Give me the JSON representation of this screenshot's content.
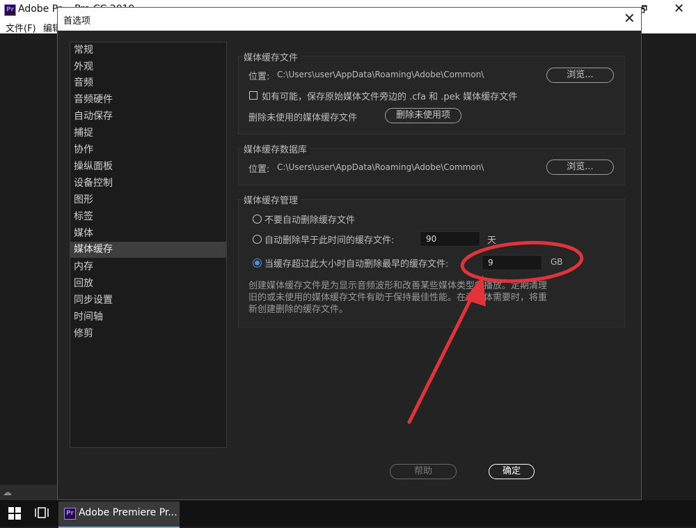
{
  "app": {
    "title": "Adobe Pr… Pro CC 2019",
    "menu": [
      "文件(F)",
      "编辑"
    ],
    "restore_glyph": "🗗",
    "close_glyph": "✕"
  },
  "taskbar": {
    "app_label": "Adobe Premiere Pr...",
    "app_logo": "Pr"
  },
  "dialog": {
    "title": "首选项",
    "close_glyph": "✕",
    "sidebar": [
      {
        "label": "常规"
      },
      {
        "label": "外观"
      },
      {
        "label": "音频"
      },
      {
        "label": "音频硬件"
      },
      {
        "label": "自动保存"
      },
      {
        "label": "捕捉"
      },
      {
        "label": "协作"
      },
      {
        "label": "操纵面板"
      },
      {
        "label": "设备控制"
      },
      {
        "label": "图形"
      },
      {
        "label": "标签"
      },
      {
        "label": "媒体"
      },
      {
        "label": "媒体缓存",
        "selected": true
      },
      {
        "label": "内存"
      },
      {
        "label": "回放"
      },
      {
        "label": "同步设置"
      },
      {
        "label": "时间轴"
      },
      {
        "label": "修剪"
      }
    ],
    "cache_files": {
      "title": "媒体缓存文件",
      "location_label": "位置:",
      "location_path": "C:\\Users\\user\\AppData\\Roaming\\Adobe\\Common\\",
      "browse_label": "浏览...",
      "save_next_label": "如有可能，保存原始媒体文件旁边的 .cfa 和 .pek 媒体缓存文件",
      "save_next_checked": false,
      "delete_unused_label": "删除未使用的媒体缓存文件",
      "delete_unused_button": "删除未使用项"
    },
    "cache_database": {
      "title": "媒体缓存数据库",
      "location_label": "位置:",
      "location_path": "C:\\Users\\user\\AppData\\Roaming\\Adobe\\Common\\",
      "browse_label": "浏览..."
    },
    "cache_management": {
      "title": "媒体缓存管理",
      "option_no_delete": "不要自动删除缓存文件",
      "option_older_than": "自动删除早于此时间的缓存文件:",
      "older_than_value": "90",
      "older_than_unit": "天",
      "option_exceeds_size": "当缓存超过此大小时自动删除最早的缓存文件:",
      "size_value": "9",
      "size_unit": "GB",
      "selected_option": "exceeds_size",
      "description": "创建媒体缓存文件是为显示音频波形和改善某些媒体类型的播放。定期清理旧的或未使用的媒体缓存文件有助于保持最佳性能。在源媒体需要时，将重新创建删除的缓存文件。"
    },
    "footer": {
      "help_label": "帮助",
      "ok_label": "确定"
    }
  },
  "colors": {
    "dialog_bg": "#232323",
    "sidebar_selected": "#3e3e3e",
    "accent_radio": "#4b8de0",
    "annotation_red": "#e0343a"
  }
}
